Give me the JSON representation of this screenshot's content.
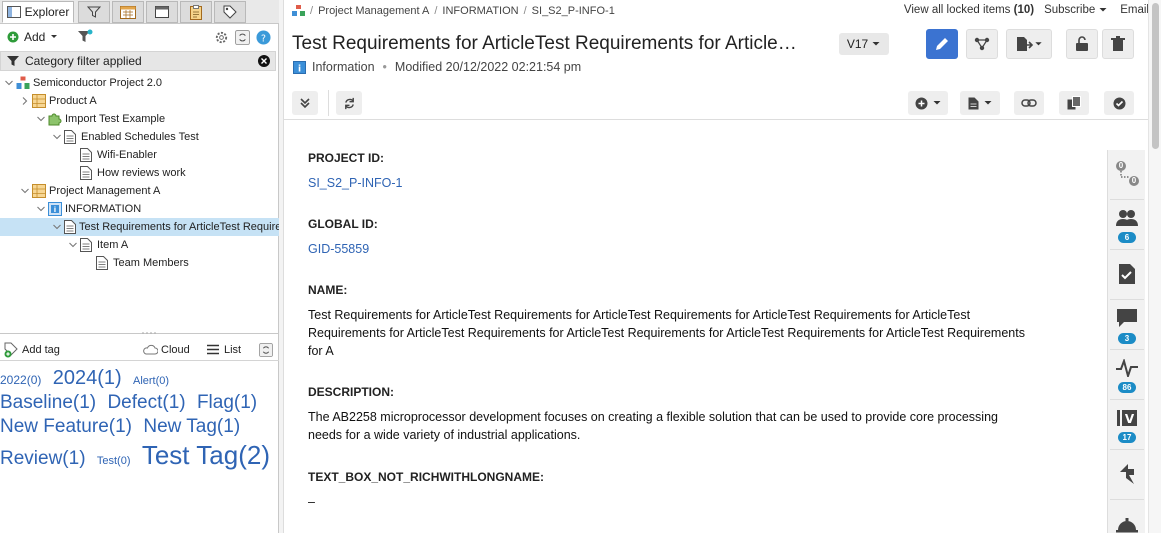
{
  "left": {
    "tabs": [
      {
        "label": "Explorer",
        "icon": "explorer-icon"
      },
      {
        "label": "",
        "icon": "filter-icon"
      },
      {
        "label": "",
        "icon": "calendar-icon"
      },
      {
        "label": "",
        "icon": "window-icon"
      },
      {
        "label": "",
        "icon": "clipboard-icon"
      },
      {
        "label": "",
        "icon": "tag-icon"
      }
    ],
    "add_label": "Add",
    "filter_text": "Category filter applied",
    "tree": [
      {
        "label": "Semiconductor Project 2.0",
        "depth": 0,
        "caret": "down",
        "icon": "project-icon"
      },
      {
        "label": "Product A",
        "depth": 1,
        "caret": "right",
        "icon": "folder-grid-icon"
      },
      {
        "label": "Import Test Example",
        "depth": 2,
        "caret": "down",
        "icon": "puzzle-icon"
      },
      {
        "label": "Enabled Schedules Test",
        "depth": 3,
        "caret": "down",
        "icon": "document-icon"
      },
      {
        "label": "Wifi-Enabler",
        "depth": 4,
        "caret": "",
        "icon": "document-icon"
      },
      {
        "label": "How reviews work",
        "depth": 4,
        "caret": "",
        "icon": "document-icon"
      },
      {
        "label": "Project Management A",
        "depth": 1,
        "caret": "down",
        "icon": "folder-grid-icon"
      },
      {
        "label": "INFORMATION",
        "depth": 2,
        "caret": "down",
        "icon": "info-icon"
      },
      {
        "label": "Test Requirements for ArticleTest Requirements for Article",
        "depth": 3,
        "caret": "down",
        "icon": "document-icon",
        "selected": true
      },
      {
        "label": "Item A",
        "depth": 4,
        "caret": "down",
        "icon": "document-icon"
      },
      {
        "label": "Team Members",
        "depth": 5,
        "caret": "",
        "icon": "document-icon"
      }
    ],
    "tagbar": {
      "add_tag": "Add tag",
      "cloud": "Cloud",
      "list": "List"
    },
    "tags": [
      {
        "text": "2022(0)",
        "size": 12
      },
      {
        "text": "2024(1)",
        "size": 20
      },
      {
        "text": "Alert(0)",
        "size": 11
      },
      {
        "text": "Baseline(1)",
        "size": 19
      },
      {
        "text": "Defect(1)",
        "size": 19
      },
      {
        "text": "Flag(1)",
        "size": 19
      },
      {
        "text": "New Feature(1)",
        "size": 19
      },
      {
        "text": "New Tag(1)",
        "size": 19
      },
      {
        "text": "Review(1)",
        "size": 19
      },
      {
        "text": "Test(0)",
        "size": 11
      },
      {
        "text": "Test Tag(2)",
        "size": 26
      }
    ]
  },
  "main": {
    "breadcrumb": [
      "Project Management A",
      "INFORMATION",
      "SI_S2_P-INFO-1"
    ],
    "locked_prefix": "View all locked items",
    "locked_count": "(10)",
    "subscribe": "Subscribe",
    "email": "Email",
    "title": "Test Requirements for ArticleTest Requirements for Article…",
    "version": "V17",
    "meta_type": "Information",
    "meta_modified": "Modified 20/12/2022 02:21:54 pm",
    "fields": [
      {
        "label": "PROJECT ID:",
        "value": "SI_S2_P-INFO-1",
        "link": true
      },
      {
        "label": "GLOBAL ID:",
        "value": "GID-55859",
        "link": true
      },
      {
        "label": "NAME:",
        "value": "Test Requirements for ArticleTest Requirements for ArticleTest Requirements for ArticleTest Requirements for ArticleTest Requirements for ArticleTest Requirements for ArticleTest Requirements for ArticleTest Requirements for ArticleTest Requirements for A",
        "link": false
      },
      {
        "label": "DESCRIPTION:",
        "value": "The AB2258 microprocessor development focuses on creating a flexible solution that can be used to provide core processing needs for a wide variety of industrial applications.",
        "link": false
      },
      {
        "label": "TEXT_BOX_NOT_RICHWITHLONGNAME:",
        "value": "–",
        "link": false
      }
    ],
    "rail": [
      {
        "icon": "relationships-icon",
        "badge": "",
        "top_count": "0",
        "bottom_count": "0"
      },
      {
        "icon": "users-icon",
        "badge": "6"
      },
      {
        "icon": "tasks-icon",
        "badge": ""
      },
      {
        "icon": "comments-icon",
        "badge": "3"
      },
      {
        "icon": "activity-icon",
        "badge": "86"
      },
      {
        "icon": "versions-icon",
        "badge": "17"
      },
      {
        "icon": "sync-icon",
        "badge": ""
      },
      {
        "icon": "bell-icon",
        "badge": ""
      }
    ]
  },
  "colors": {
    "accent": "#3b73d1",
    "link": "#2f64b4",
    "badge": "#1c8cc6",
    "selected_row": "#c6e2f5"
  }
}
